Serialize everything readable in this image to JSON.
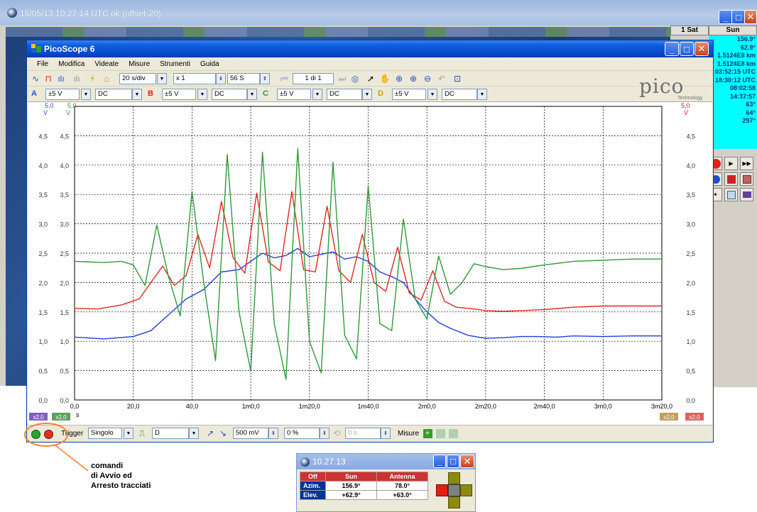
{
  "outer_window": {
    "title": "15/05/13  10.27.14 UTC   ok (offset-20)"
  },
  "info_panel": {
    "col1_header": "1 Sat",
    "col2_header": "Sun",
    "sun_values": [
      "156.9°",
      "62.9°",
      "1.5124E8 km",
      "1.5124E8 km",
      "03:52:15 UTC",
      "18:30:12 UTC",
      "08:02:58",
      "14:37:57",
      "63°",
      "64°",
      "297°"
    ]
  },
  "picoscope": {
    "title": "PicoScope 6",
    "menu": [
      "File",
      "Modifica",
      "Videate",
      "Misure",
      "Strumenti",
      "Guida"
    ],
    "toolbar": {
      "timebase": "20 s/div",
      "zoom": "x 1",
      "samples": "56 S",
      "page": "1 di 1"
    },
    "channels": [
      {
        "id": "A",
        "range": "±5 V",
        "coupling": "DC"
      },
      {
        "id": "B",
        "range": "±5 V",
        "coupling": "DC"
      },
      {
        "id": "C",
        "range": "±5 V",
        "coupling": "DC"
      },
      {
        "id": "D",
        "range": "±5 V",
        "coupling": "DC"
      }
    ],
    "brand": "pico",
    "brand_sub": "Technology",
    "bottom": {
      "trigger_label": "Trigger",
      "trigger_mode": "Singolo",
      "trigger_source": "D",
      "threshold": "500 mV",
      "pretrigger": "0 %",
      "delay": "0 s",
      "measures_label": "Misure"
    }
  },
  "chart_data": {
    "type": "line",
    "xlabel": "s",
    "ylabel": "V",
    "xlim": [
      0,
      200
    ],
    "ylim": [
      0,
      5
    ],
    "x_tick_labels": [
      "0,0",
      "20,0",
      "40,0",
      "1m0,0",
      "1m20,0",
      "1m40,0",
      "2m0,0",
      "2m20,0",
      "2m40,0",
      "3m0,0",
      "3m20,0"
    ],
    "y_tick_labels": [
      "0,0",
      "0,5",
      "1,0",
      "1,5",
      "2,0",
      "2,5",
      "3,0",
      "3,5",
      "4,0",
      "4,5",
      "5,0"
    ],
    "top_left_labels": [
      "5,0",
      "V",
      "5,0",
      "V"
    ],
    "top_right_labels": [
      "5,0",
      "V"
    ],
    "scale_badges": [
      "x2,0",
      "x2,0",
      "x2,0",
      "x2,0"
    ],
    "series": [
      {
        "color": "#1f3fd8",
        "x": [
          0,
          10,
          20,
          26,
          32,
          38,
          44,
          50,
          56,
          60,
          64,
          68,
          72,
          76,
          80,
          84,
          88,
          92,
          96,
          100,
          104,
          108,
          112,
          116,
          120,
          124,
          128,
          134,
          140,
          146,
          152,
          158,
          164,
          170,
          180,
          190,
          200
        ],
        "values": [
          1.07,
          1.04,
          1.08,
          1.18,
          1.45,
          1.72,
          1.88,
          2.18,
          2.22,
          2.36,
          2.5,
          2.42,
          2.46,
          2.58,
          2.44,
          2.48,
          2.52,
          2.4,
          2.44,
          2.36,
          2.18,
          2.1,
          2.0,
          1.72,
          1.5,
          1.32,
          1.22,
          1.1,
          1.05,
          1.06,
          1.08,
          1.08,
          1.07,
          1.09,
          1.08,
          1.09,
          1.09
        ]
      },
      {
        "color": "#e02820",
        "x": [
          0,
          8,
          16,
          22,
          26,
          30,
          34,
          38,
          42,
          46,
          50,
          54,
          58,
          62,
          66,
          70,
          74,
          78,
          82,
          86,
          90,
          94,
          98,
          102,
          106,
          110,
          114,
          118,
          122,
          126,
          130,
          136,
          140,
          146,
          152,
          160,
          170,
          180,
          190,
          200
        ],
        "values": [
          1.56,
          1.55,
          1.62,
          1.72,
          2.0,
          2.28,
          1.95,
          2.12,
          2.82,
          2.25,
          3.38,
          2.42,
          2.16,
          3.52,
          2.35,
          2.2,
          3.55,
          2.22,
          2.18,
          3.3,
          2.2,
          2.0,
          2.82,
          2.0,
          1.85,
          2.6,
          1.82,
          1.7,
          2.2,
          1.68,
          1.58,
          1.55,
          1.52,
          1.51,
          1.52,
          1.54,
          1.58,
          1.6,
          1.6,
          1.6
        ]
      },
      {
        "color": "#2e9a3a",
        "x": [
          0,
          10,
          16,
          20,
          24,
          28,
          32,
          36,
          40,
          44,
          48,
          52,
          56,
          60,
          64,
          68,
          72,
          76,
          80,
          84,
          88,
          92,
          96,
          100,
          104,
          108,
          112,
          116,
          120,
          124,
          128,
          132,
          136,
          140,
          146,
          152,
          160,
          170,
          180,
          190,
          200
        ],
        "values": [
          2.36,
          2.34,
          2.36,
          2.3,
          1.95,
          2.98,
          2.1,
          1.43,
          3.55,
          2.0,
          0.67,
          4.18,
          1.5,
          0.49,
          4.22,
          1.3,
          0.35,
          4.28,
          1.0,
          0.46,
          4.05,
          1.1,
          0.7,
          3.65,
          1.3,
          1.18,
          3.08,
          1.72,
          1.38,
          2.45,
          1.8,
          2.0,
          2.32,
          2.27,
          2.22,
          2.24,
          2.3,
          2.36,
          2.38,
          2.4,
          2.4
        ]
      }
    ]
  },
  "mini_window": {
    "title": "10.27.13",
    "headers": [
      "Off",
      "Sun",
      "Antenna"
    ],
    "rows": [
      {
        "label": "Azim.",
        "sun": "156.9°",
        "antenna": "78.0°"
      },
      {
        "label": "Elev.",
        "sun": "+62.9°",
        "antenna": "+63.0°"
      }
    ]
  },
  "annotation": {
    "lines": [
      "comandi",
      "di Avvio ed",
      "Arresto tracciati"
    ],
    "color": "#ff7f27"
  }
}
